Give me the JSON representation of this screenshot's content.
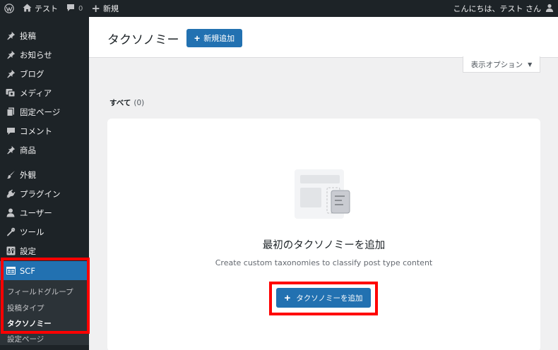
{
  "adminbar": {
    "site_name": "テスト",
    "comment_count": "0",
    "new_label": "新規",
    "greeting": "こんにちは、テスト さん"
  },
  "sidebar": {
    "items": [
      {
        "label": "投稿",
        "icon": "pin-icon"
      },
      {
        "label": "お知らせ",
        "icon": "pin-icon"
      },
      {
        "label": "ブログ",
        "icon": "pin-icon"
      },
      {
        "label": "メディア",
        "icon": "media-icon"
      },
      {
        "label": "固定ページ",
        "icon": "page-icon"
      },
      {
        "label": "コメント",
        "icon": "comment-icon"
      },
      {
        "label": "商品",
        "icon": "pin-icon"
      },
      {
        "label": "外観",
        "icon": "brush-icon"
      },
      {
        "label": "プラグイン",
        "icon": "plugin-icon"
      },
      {
        "label": "ユーザー",
        "icon": "user-icon"
      },
      {
        "label": "ツール",
        "icon": "wrench-icon"
      },
      {
        "label": "設定",
        "icon": "settings-icon"
      },
      {
        "label": "SCF",
        "icon": "scf-icon"
      }
    ],
    "submenu": [
      "フィールドグループ",
      "投稿タイプ",
      "タクソノミー",
      "設定ページ"
    ]
  },
  "header": {
    "title": "タクソノミー",
    "add_new": "新規追加"
  },
  "screen_options": "表示オプション",
  "filter": {
    "label": "すべて",
    "count": "(0)"
  },
  "empty_state": {
    "title": "最初のタクソノミーを追加",
    "description": "Create custom taxonomies to classify post type content",
    "button": "タクソノミーを追加"
  },
  "colors": {
    "accent": "#2271b1",
    "sidebar_bg": "#1d2327",
    "highlight": "#ff0000"
  }
}
